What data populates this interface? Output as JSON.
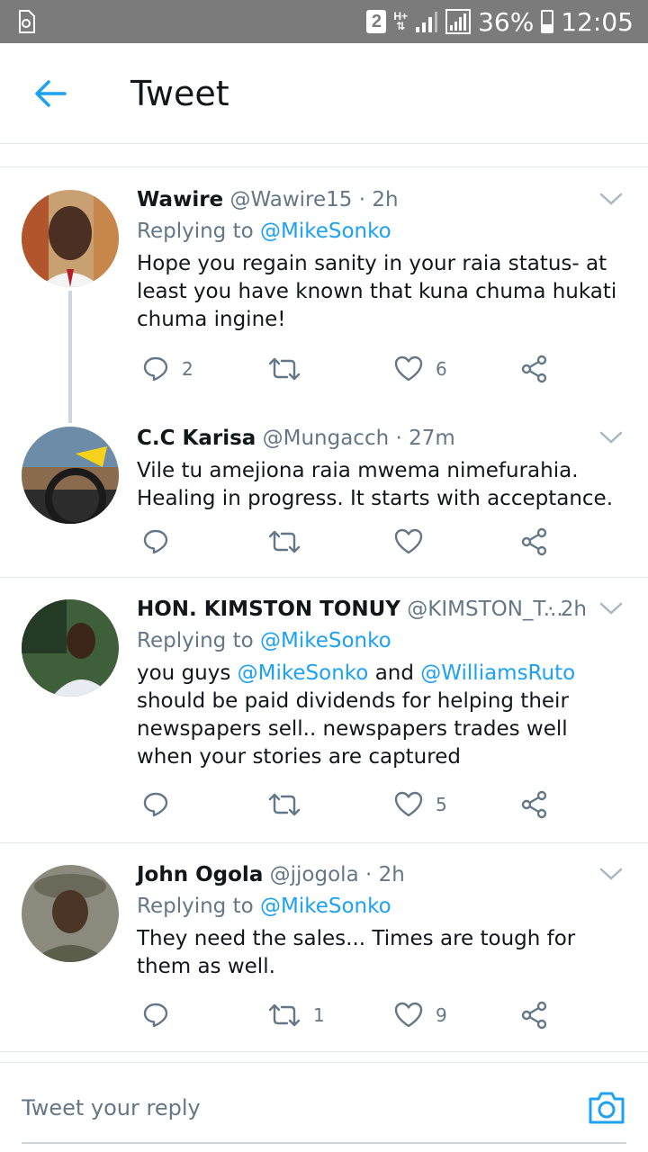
{
  "status_bar": {
    "sim_slot": "2",
    "network_type": "H+",
    "battery_percent": "36%",
    "battery_level": 0.36,
    "time": "12:05"
  },
  "header": {
    "title": "Tweet",
    "back_icon": "arrow-left-icon"
  },
  "colors": {
    "accent": "#1da1f2",
    "text_primary": "#14171a",
    "text_secondary": "#657786",
    "status_bar": "#7b7b7b",
    "divider": "#e1e8ed"
  },
  "tweets": [
    {
      "name": "Wawire",
      "handle": "@Wawire15",
      "time": "· 2h",
      "replying_label": "Replying to",
      "replying_to": "@MikeSonko",
      "text": "Hope you regain sanity in your raia status- at least you have known that kuna chuma hukati chuma ingine!",
      "replies": "2",
      "retweets": "",
      "likes": "6"
    },
    {
      "name": "C.C Karisa",
      "handle": "@Mungacch",
      "time": "· 27m",
      "text": "Vile tu amejiona raia mwema nimefurahia. Healing in progress. It starts with acceptance.",
      "replies": "",
      "retweets": "",
      "likes": ""
    },
    {
      "name": "HON. KIMSTON TONUY",
      "handle": "@KIMSTON_T...",
      "time": "· 2h",
      "replying_label": "Replying to",
      "replying_to": "@MikeSonko",
      "text_part1": "you guys",
      "mention1": "@MikeSonko",
      "text_part2": "and",
      "mention2": "@WilliamsRuto",
      "text_part3": "should be paid dividends for helping their newspapers sell.. newspapers trades well when your stories are captured",
      "replies": "",
      "retweets": "",
      "likes": "5"
    },
    {
      "name": "John Ogola",
      "handle": "@jjogola",
      "time": "· 2h",
      "replying_label": "Replying to",
      "replying_to": "@MikeSonko",
      "text": "They need the sales... Times are tough for them as well.",
      "replies": "",
      "retweets": "1",
      "likes": "9"
    }
  ],
  "reply_bar": {
    "placeholder": "Tweet your reply",
    "camera_icon": "camera-icon"
  }
}
